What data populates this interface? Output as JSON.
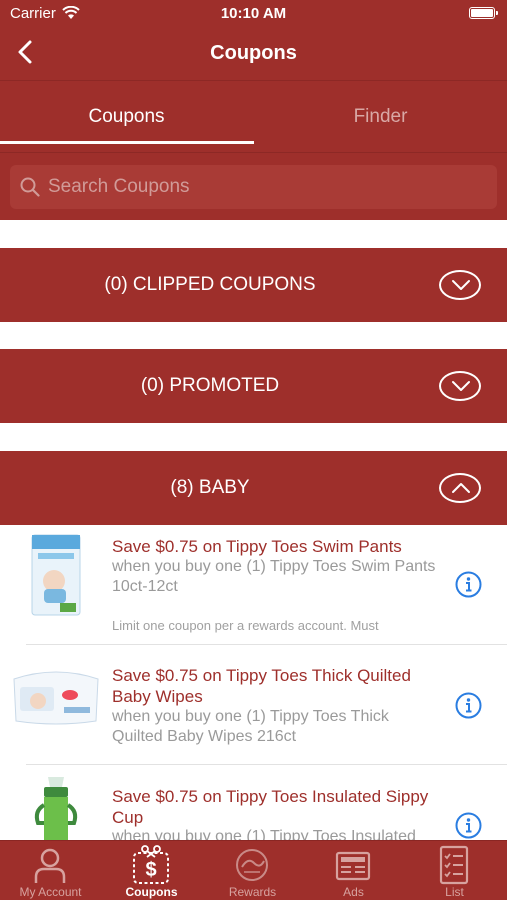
{
  "status": {
    "carrier": "Carrier",
    "time": "10:10 AM"
  },
  "nav": {
    "title": "Coupons"
  },
  "tabs": [
    {
      "label": "Coupons",
      "active": true
    },
    {
      "label": "Finder",
      "active": false
    }
  ],
  "search": {
    "placeholder": "Search Coupons",
    "value": ""
  },
  "sections": [
    {
      "label": "(0) CLIPPED COUPONS",
      "expanded": false
    },
    {
      "label": "(0) PROMOTED",
      "expanded": false
    },
    {
      "label": "(8) BABY",
      "expanded": true
    }
  ],
  "coupons": [
    {
      "title": "Save $0.75 on Tippy Toes Swim Pants",
      "description": "when you buy one (1) Tippy Toes Swim Pants 10ct-12ct",
      "limit": "Limit one coupon per a rewards account. Must"
    },
    {
      "title": "Save $0.75 on Tippy Toes Thick Quilted Baby Wipes",
      "description": "when you buy one (1) Tippy Toes Thick Quilted Baby Wipes 216ct",
      "limit": ""
    },
    {
      "title": "Save $0.75 on Tippy Toes Insulated Sippy Cup",
      "description": "when you buy one (1) Tippy Toes Insulated",
      "limit": ""
    }
  ],
  "tab_bar": [
    {
      "label": "My Account",
      "icon": "user-icon",
      "active": false
    },
    {
      "label": "Coupons",
      "icon": "scissors-coupon-icon",
      "active": true
    },
    {
      "label": "Rewards",
      "icon": "rewards-logo-icon",
      "active": false
    },
    {
      "label": "Ads",
      "icon": "newspaper-icon",
      "active": false
    },
    {
      "label": "List",
      "icon": "checklist-icon",
      "active": false
    }
  ],
  "colors": {
    "brand": "#9e2f2b",
    "info": "#2a7de1",
    "muted": "#9a9a9a"
  }
}
